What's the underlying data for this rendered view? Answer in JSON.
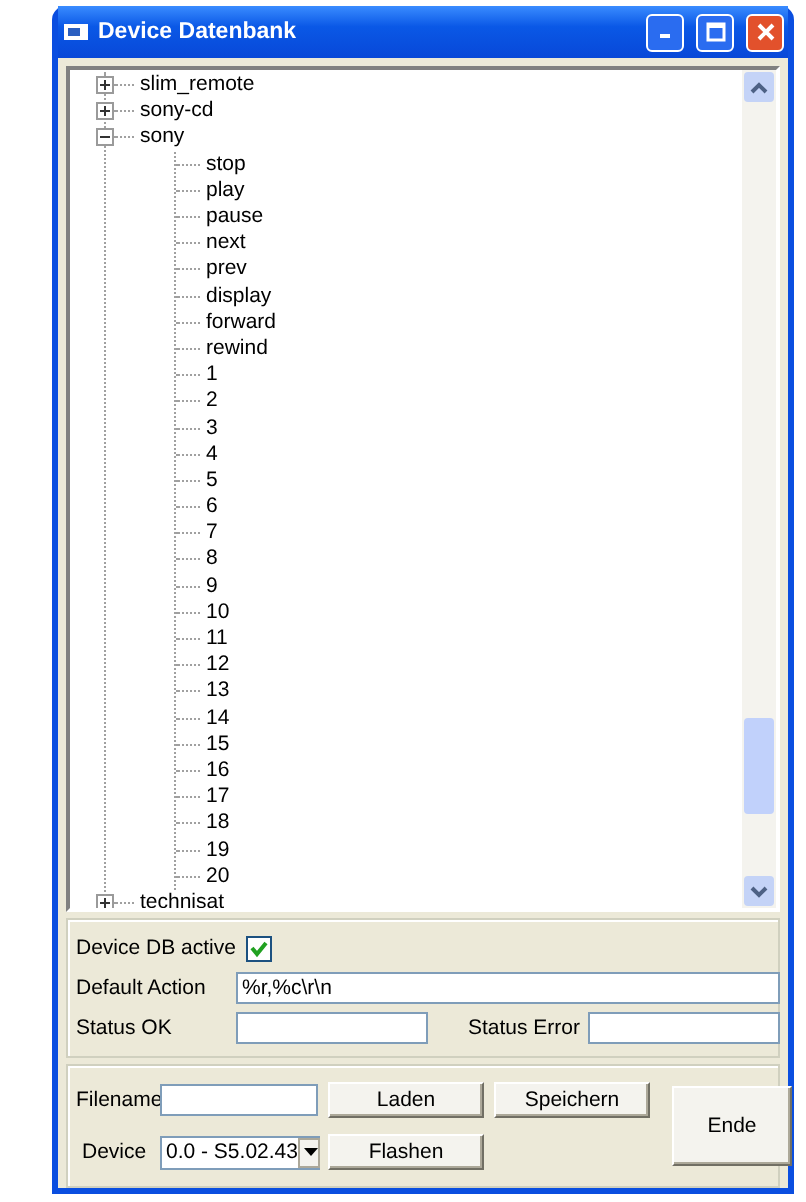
{
  "window": {
    "title": "Device Datenbank"
  },
  "tree": {
    "items": [
      {
        "label": "slim_remote",
        "expanded": false
      },
      {
        "label": "sony-cd",
        "expanded": false
      },
      {
        "label": "sony",
        "expanded": true,
        "children": [
          {
            "label": "stop"
          },
          {
            "label": "play"
          },
          {
            "label": "pause"
          },
          {
            "label": "next"
          },
          {
            "label": "prev"
          },
          {
            "label": "display"
          },
          {
            "label": "forward"
          },
          {
            "label": "rewind"
          },
          {
            "label": "1"
          },
          {
            "label": "2"
          },
          {
            "label": "3"
          },
          {
            "label": "4"
          },
          {
            "label": "5"
          },
          {
            "label": "6"
          },
          {
            "label": "7"
          },
          {
            "label": "8"
          },
          {
            "label": "9"
          },
          {
            "label": "10"
          },
          {
            "label": "11"
          },
          {
            "label": "12"
          },
          {
            "label": "13"
          },
          {
            "label": "14"
          },
          {
            "label": "15"
          },
          {
            "label": "16"
          },
          {
            "label": "17"
          },
          {
            "label": "18"
          },
          {
            "label": "19"
          },
          {
            "label": "20"
          }
        ]
      },
      {
        "label": "technisat",
        "expanded": false
      }
    ]
  },
  "settings": {
    "db_active": {
      "label": "Device DB active",
      "checked": true
    },
    "default_action": {
      "label": "Default Action",
      "value": "%r,%c\\r\\n"
    },
    "status_ok": {
      "label": "Status OK"
    },
    "status_error": {
      "label": "Status Error"
    }
  },
  "file": {
    "filename": {
      "label": "Filename"
    },
    "device": {
      "label": "Device",
      "value": "0.0 - S5.02.43"
    },
    "load_button": "Laden",
    "save_button": "Speichern",
    "flash_button": "Flashen",
    "end_button": "Ende"
  }
}
